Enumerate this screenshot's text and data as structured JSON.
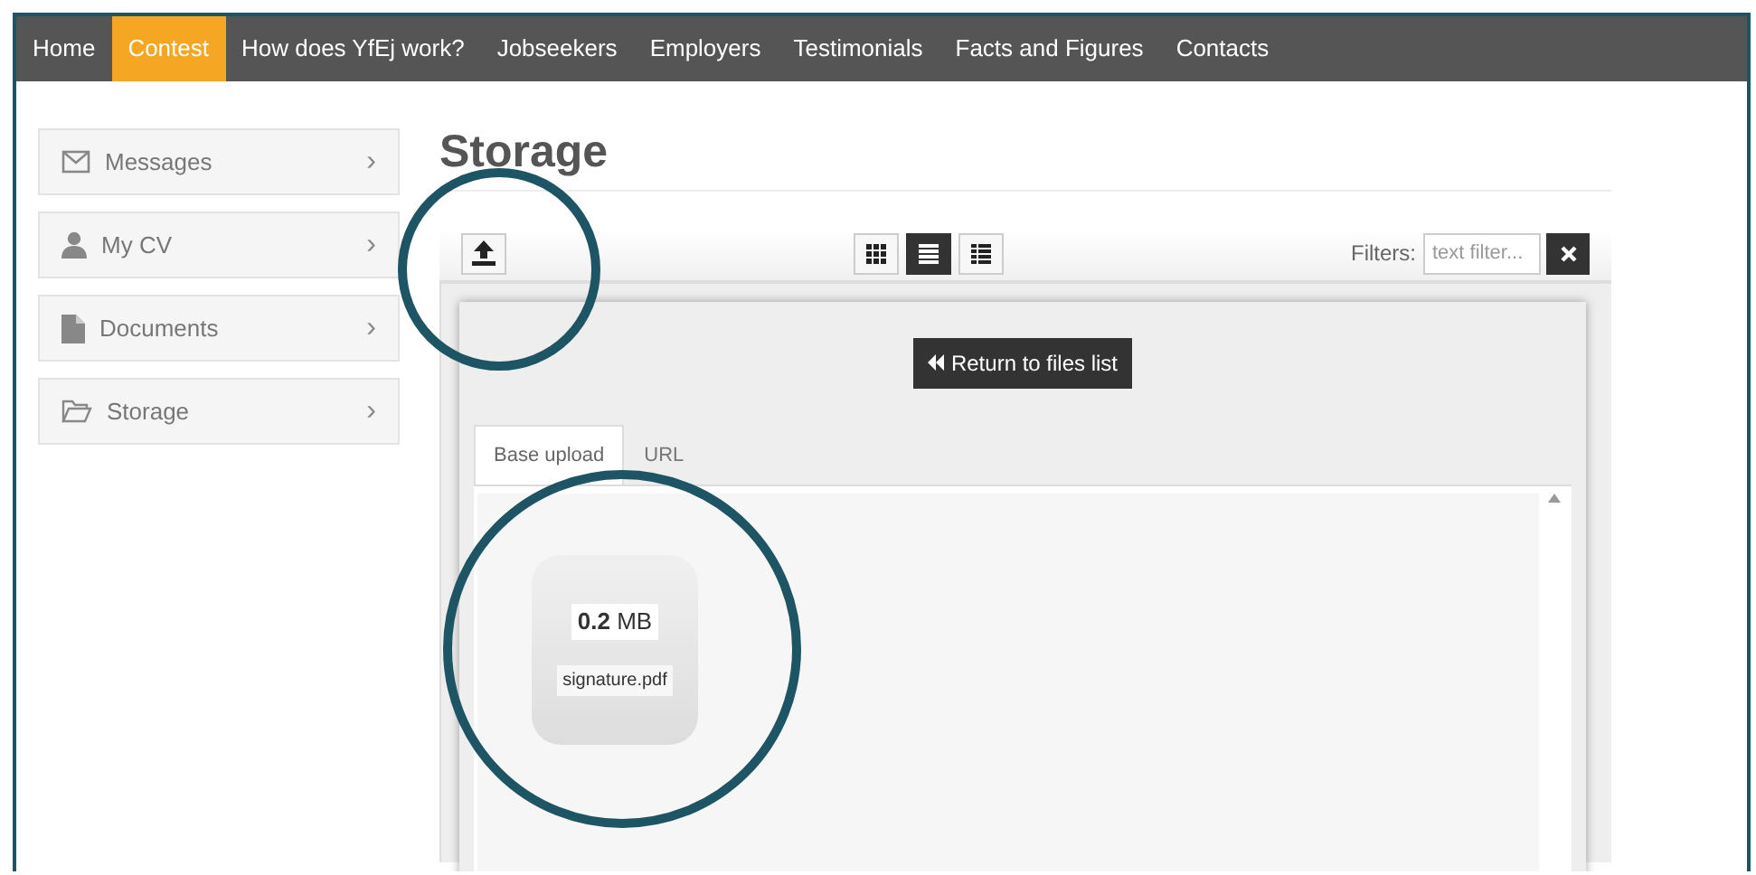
{
  "nav": [
    {
      "label": "Home",
      "selected": false
    },
    {
      "label": "Contest",
      "selected": true
    },
    {
      "label": "How does YfEj work?",
      "selected": false
    },
    {
      "label": "Jobseekers",
      "selected": false
    },
    {
      "label": "Employers",
      "selected": false
    },
    {
      "label": "Testimonials",
      "selected": false
    },
    {
      "label": "Facts and Figures",
      "selected": false
    },
    {
      "label": "Contacts",
      "selected": false
    }
  ],
  "sidebar": {
    "items": [
      {
        "kind": "envelope",
        "label": "Messages",
        "chevron": "›"
      },
      {
        "kind": "person",
        "label": "My CV",
        "chevron": "›"
      },
      {
        "kind": "document",
        "label": "Documents",
        "chevron": "›"
      },
      {
        "kind": "folder",
        "label": "Storage",
        "chevron": "›"
      }
    ]
  },
  "page_title": "Storage",
  "toolbar": {
    "view_buttons": [
      {
        "kind": "grid",
        "selected": false
      },
      {
        "kind": "list",
        "selected": true
      },
      {
        "kind": "table",
        "selected": false
      }
    ],
    "filters_label": "Filters:",
    "filter": {
      "placeholder": "text filter..."
    }
  },
  "modal": {
    "return_button": "Return to files list",
    "tabs": [
      {
        "label": "Base upload",
        "selected": true
      },
      {
        "label": "URL",
        "selected": false
      }
    ],
    "files": [
      {
        "size": "**0.2** MB",
        "name": "signature.pdf"
      }
    ]
  }
}
